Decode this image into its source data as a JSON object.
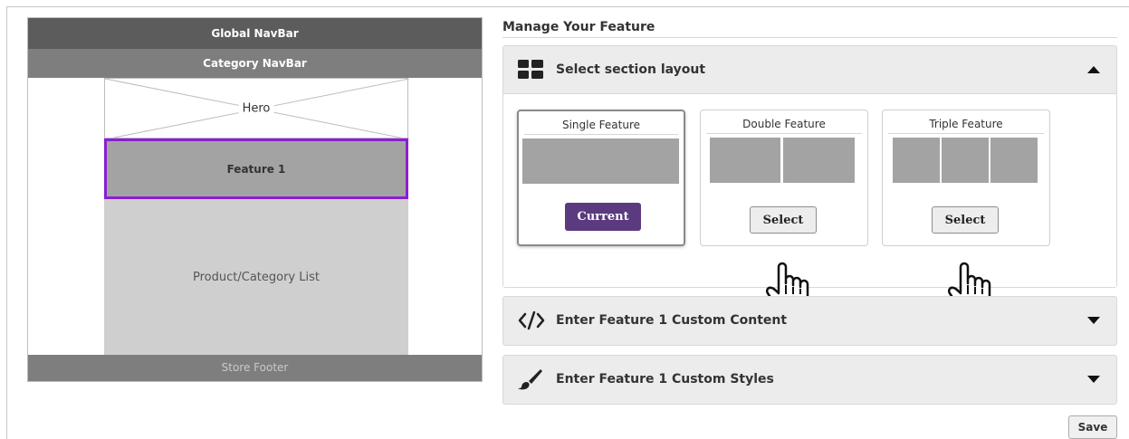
{
  "preview": {
    "global_navbar": "Global NavBar",
    "category_navbar": "Category NavBar",
    "hero": "Hero",
    "feature1": "Feature 1",
    "product_list": "Product/Category List",
    "store_footer": "Store Footer"
  },
  "panel": {
    "title": "Manage Your Feature",
    "sections": {
      "layout": {
        "label": "Select section layout",
        "icon": "grid-layout-icon",
        "expanded": true
      },
      "content": {
        "label": "Enter Feature 1 Custom Content",
        "icon": "code-icon",
        "expanded": false
      },
      "styles": {
        "label": "Enter Feature 1 Custom Styles",
        "icon": "paintbrush-icon",
        "expanded": false
      }
    },
    "layouts": [
      {
        "title": "Single Feature",
        "button": "Current",
        "columns": 1,
        "current": true
      },
      {
        "title": "Double Feature",
        "button": "Select",
        "columns": 2,
        "current": false
      },
      {
        "title": "Triple Feature",
        "button": "Select",
        "columns": 3,
        "current": false
      }
    ],
    "save_label": "Save"
  },
  "colors": {
    "accent_purple": "#5b3a80",
    "selected_outline": "#8b1fd1",
    "navbar_dark": "#5c5c5c",
    "navbar_mid": "#7e7e7e"
  }
}
